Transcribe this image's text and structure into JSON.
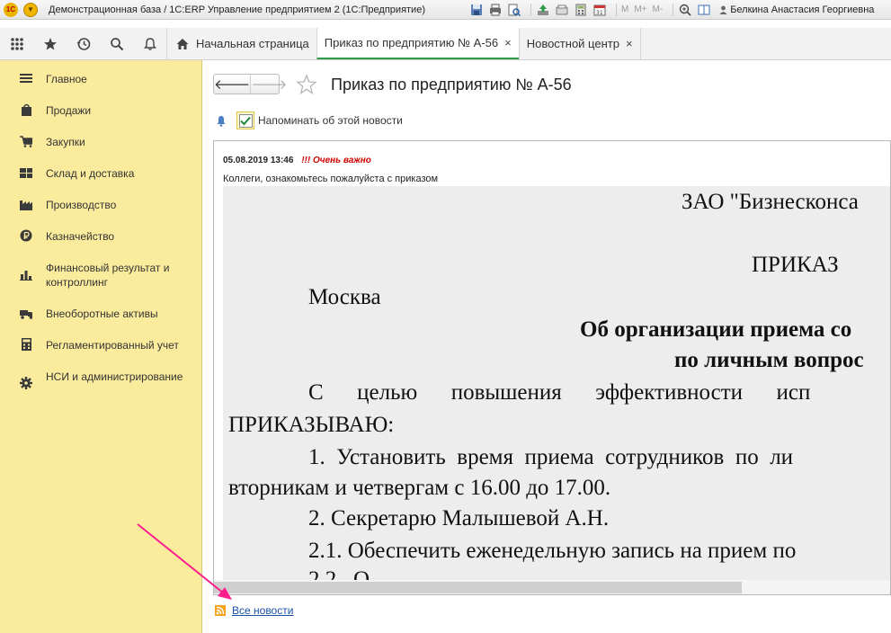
{
  "window": {
    "title": "Демонстрационная база / 1С:ERP Управление предприятием 2  (1С:Предприятие)",
    "logo_text": "1С",
    "memory_buttons": [
      "M",
      "M+",
      "M-"
    ],
    "user": "Белкина Анастасия Георгиевна"
  },
  "tabs": {
    "home": "Начальная страница",
    "items": [
      {
        "label": "Приказ по предприятию № А-56",
        "active": true
      },
      {
        "label": "Новостной центр",
        "active": false
      }
    ],
    "close_glyph": "×"
  },
  "sidebar": {
    "items": [
      {
        "label": "Главное",
        "icon": "menu-lines-icon"
      },
      {
        "label": "Продажи",
        "icon": "shopping-bag-icon"
      },
      {
        "label": "Закупки",
        "icon": "cart-icon"
      },
      {
        "label": "Склад и доставка",
        "icon": "warehouse-icon"
      },
      {
        "label": "Производство",
        "icon": "factory-icon"
      },
      {
        "label": "Казначейство",
        "icon": "ruble-coin-icon"
      },
      {
        "label": "Финансовый результат и контроллинг",
        "icon": "bar-chart-icon"
      },
      {
        "label": "Внеоборотные активы",
        "icon": "truck-icon"
      },
      {
        "label": "Регламентированный учет",
        "icon": "calculator-icon"
      },
      {
        "label": "НСИ и администрирование",
        "icon": "gear-icon"
      }
    ]
  },
  "document": {
    "title": "Приказ по предприятию № А-56",
    "remind_label": "Напоминать об этой новости",
    "remind_checked": true,
    "news_date": "05.08.2019 13:46",
    "news_importance": "!!! Очень важно",
    "news_intro": "Коллеги, ознакомьтесь пожалуйста с приказом",
    "scan_lines": [
      "ЗАО \"Бизнесконса",
      "ПРИКАЗ",
      "Москва",
      "Об организации приема со",
      "по личным вопрос",
      "С      целью      повышения      эффективности      исп",
      "ПРИКАЗЫВАЮ:",
      "1.  Установить  время  приема  сотрудников  по  ли",
      "вторникам и четвергам с 16.00 до 17.00.",
      "2. Секретарю Малышевой А.Н.",
      "2.1. Обеспечить еженедельную запись на прием по",
      "2.2.  О"
    ],
    "all_news_link": "Все новости"
  },
  "colors": {
    "sidebar_bg": "#fbec9d",
    "active_tab_underline": "#2e9a48",
    "importance_red": "#d00000",
    "link_blue": "#1b4fa8",
    "annotation_arrow": "#ff1e8c"
  }
}
